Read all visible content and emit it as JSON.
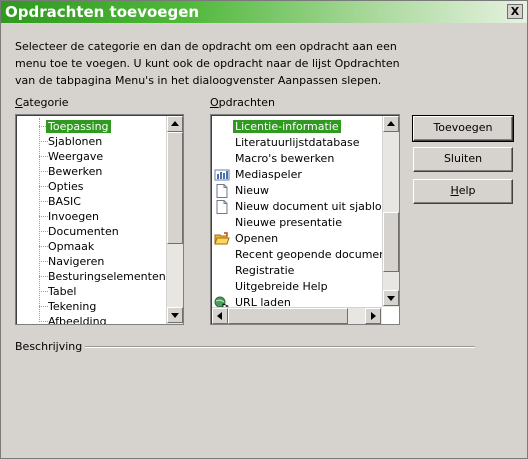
{
  "window": {
    "title": "Opdrachten toevoegen",
    "close_label": "X"
  },
  "description": "Selecteer de categorie en dan de opdracht om een opdracht aan een menu toe te voegen. U kunt ook de opdracht naar de lijst Opdrachten van de tabpagina Menu's in het dialoogvenster Aanpassen slepen.",
  "category": {
    "label_mnemonic": "C",
    "label_rest": "ategorie",
    "items": [
      "Toepassing",
      "Sjablonen",
      "Weergave",
      "Bewerken",
      "Opties",
      "BASIC",
      "Invoegen",
      "Documenten",
      "Opmaak",
      "Navigeren",
      "Besturingselementen",
      "Tabel",
      "Tekening",
      "Afbeelding"
    ],
    "selected": "Toepassing"
  },
  "commands": {
    "label_mnemonic": "O",
    "label_rest": "pdrachten",
    "items": [
      {
        "label": "Licentie-informatie",
        "icon": "none"
      },
      {
        "label": "Literatuurlijstdatabase",
        "icon": "none"
      },
      {
        "label": "Macro's bewerken",
        "icon": "none"
      },
      {
        "label": "Mediaspeler",
        "icon": "mediaplayer-icon"
      },
      {
        "label": "Nieuw",
        "icon": "new-document-icon"
      },
      {
        "label": "Nieuw document uit sjabloon",
        "icon": "new-from-template-icon"
      },
      {
        "label": "Nieuwe presentatie",
        "icon": "none"
      },
      {
        "label": "Openen",
        "icon": "open-folder-icon"
      },
      {
        "label": "Recent geopende documenten",
        "icon": "none"
      },
      {
        "label": "Registratie",
        "icon": "none"
      },
      {
        "label": "Uitgebreide Help",
        "icon": "none"
      },
      {
        "label": "URL laden",
        "icon": "load-url-icon"
      }
    ],
    "selected": "Licentie-informatie"
  },
  "buttons": {
    "add": "Toevoegen",
    "close": "Sluiten",
    "help_mnemonic": "H",
    "help_rest": "elp"
  },
  "description_group": {
    "label": "Beschrijving"
  },
  "colors": {
    "accent": "#2f9a1f",
    "title_text": "#ffffff",
    "window_bg": "#d6d3ce"
  }
}
